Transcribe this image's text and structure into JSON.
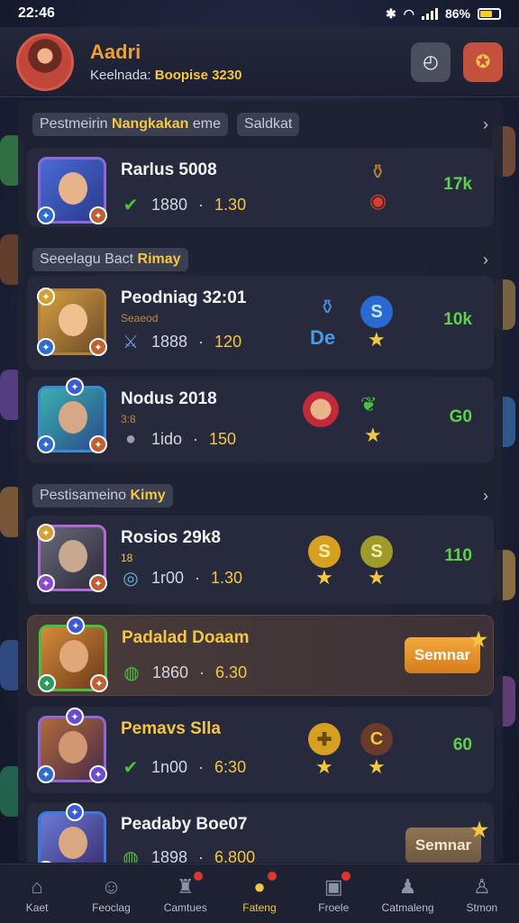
{
  "status": {
    "time": "22:46",
    "battery": "86%"
  },
  "header": {
    "player_name": "Aadri",
    "sub_label": "Keelnada:",
    "points": "Boopise 3230"
  },
  "sections": [
    {
      "chips": [
        "Pestmeirin Nangkakan eme",
        "Saldkat"
      ],
      "highlight": "Nangkakan"
    },
    {
      "chips": [
        "Seeelagu Bact Rimay"
      ],
      "highlight": "Rimay"
    },
    {
      "chips": [
        "Pestisameino Kimy"
      ],
      "highlight": "Kimy"
    }
  ],
  "rows": [
    {
      "name": "Rarlus 5008",
      "sub": "",
      "stat_a": "1880",
      "stat_b": "1.30",
      "reward": "17k",
      "action": ""
    },
    {
      "name": "Peodniag 32:01",
      "sub": "Seaeod",
      "stat_a": "1888",
      "stat_b": "120",
      "reward": "10k",
      "action": "",
      "reward_mark": "De"
    },
    {
      "name": "Nodus 2018",
      "sub": "3:8",
      "stat_a": "1ido",
      "stat_b": "150",
      "reward": "G0",
      "action": ""
    },
    {
      "name": "Rosios 29k8",
      "sub": "18",
      "stat_a": "1r00",
      "stat_b": "1.30",
      "reward": "110",
      "action": ""
    },
    {
      "name": "Padalad Doaam",
      "sub": "",
      "stat_a": "1860",
      "stat_b": "6.30",
      "reward": "",
      "action": "Semnar"
    },
    {
      "name": "Pemavs Slla",
      "sub": "",
      "stat_a": "1n00",
      "stat_b": "6:30",
      "reward": "60",
      "action": ""
    },
    {
      "name": "Peadaby Boe07",
      "sub": "",
      "stat_a": "1898",
      "stat_b": "6.800",
      "reward": "",
      "action": "Semnar"
    }
  ],
  "nav": [
    {
      "label": "Kaet",
      "icon": "home-icon"
    },
    {
      "label": "Feoclag",
      "icon": "profile-icon"
    },
    {
      "label": "Camtues",
      "icon": "castle-icon"
    },
    {
      "label": "Fateng",
      "icon": "coin-icon"
    },
    {
      "label": "Froele",
      "icon": "chest-icon"
    },
    {
      "label": "Catmaleng",
      "icon": "people-icon"
    },
    {
      "label": "Stmon",
      "icon": "user-icon"
    }
  ],
  "colors": {
    "accent": "#f5c642",
    "reward_green": "#5fd24a",
    "action_orange": "#e38f28",
    "panel": "#1e2232"
  }
}
